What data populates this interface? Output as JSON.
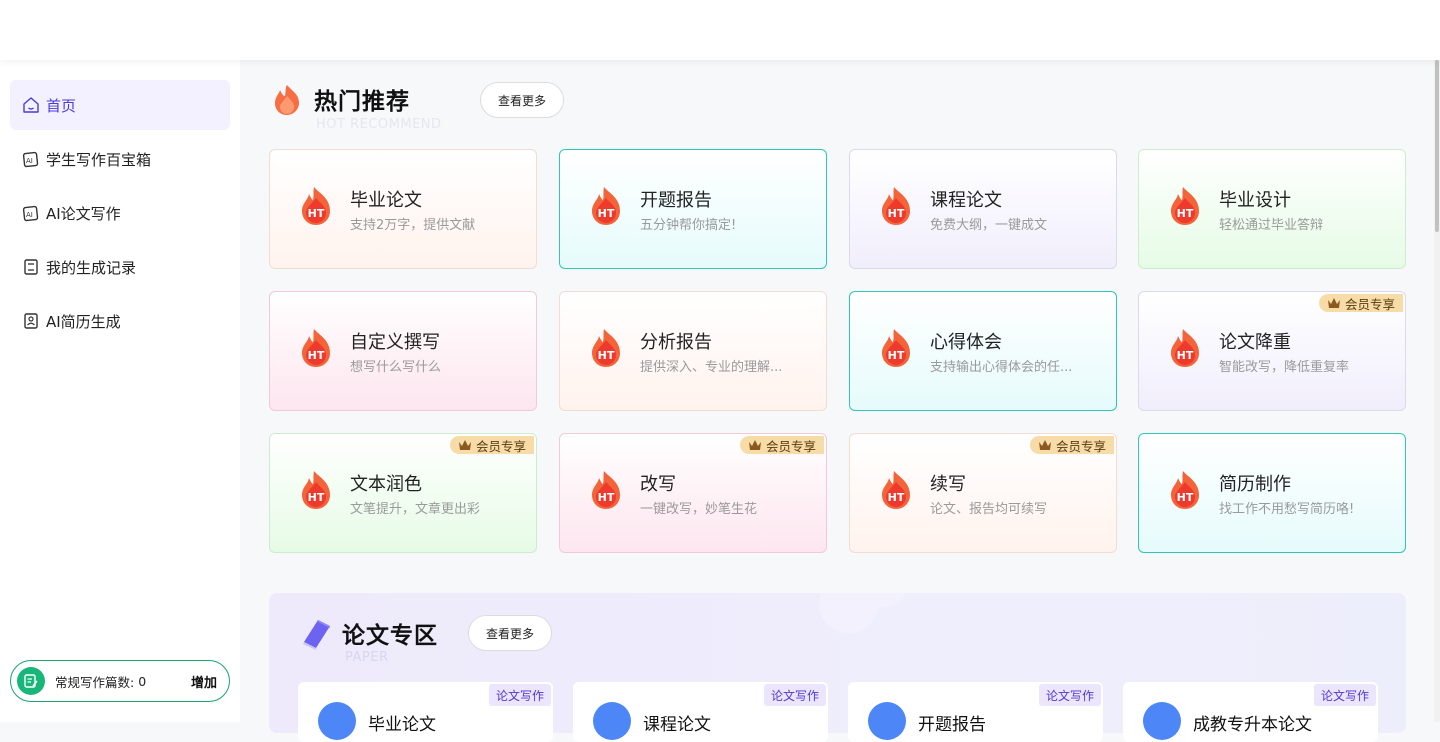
{
  "sidebar": {
    "items": [
      {
        "label": "首页",
        "icon": "home-icon",
        "active": true
      },
      {
        "label": "学生写作百宝箱",
        "icon": "ai-doc-icon"
      },
      {
        "label": "AI论文写作",
        "icon": "ai-doc-icon"
      },
      {
        "label": "我的生成记录",
        "icon": "record-icon"
      },
      {
        "label": "AI简历生成",
        "icon": "resume-icon"
      }
    ],
    "quota": {
      "label": "常规写作篇数:",
      "count": "0",
      "add_label": "增加"
    }
  },
  "hot": {
    "title": "热门推荐",
    "subtitle": "HOT RECOMMEND",
    "more_label": "查看更多",
    "cards": [
      {
        "title": "毕业论文",
        "desc": "支持2万字，提供文献",
        "badge": ""
      },
      {
        "title": "开题报告",
        "desc": "五分钟帮你搞定!",
        "badge": ""
      },
      {
        "title": "课程论文",
        "desc": "免费大纲，一键成文",
        "badge": ""
      },
      {
        "title": "毕业设计",
        "desc": "轻松通过毕业答辩",
        "badge": ""
      },
      {
        "title": "自定义撰写",
        "desc": "想写什么写什么",
        "badge": ""
      },
      {
        "title": "分析报告",
        "desc": "提供深入、专业的理解...",
        "badge": ""
      },
      {
        "title": "心得体会",
        "desc": "支持输出心得体会的任...",
        "badge": ""
      },
      {
        "title": "论文降重",
        "desc": "智能改写，降低重复率",
        "badge": "会员专享"
      },
      {
        "title": "文本润色",
        "desc": "文笔提升，文章更出彩",
        "badge": "会员专享"
      },
      {
        "title": "改写",
        "desc": "一键改写，妙笔生花",
        "badge": "会员专享"
      },
      {
        "title": "续写",
        "desc": "论文、报告均可续写",
        "badge": "会员专享"
      },
      {
        "title": "简历制作",
        "desc": "找工作不用愁写简历咯!",
        "badge": ""
      }
    ],
    "icon_text": "HT"
  },
  "paper": {
    "title": "论文专区",
    "subtitle": "PAPER",
    "more_label": "查看更多",
    "cards": [
      {
        "title": "毕业论文",
        "tag": "论文写作"
      },
      {
        "title": "课程论文",
        "tag": "论文写作"
      },
      {
        "title": "开题报告",
        "tag": "论文写作"
      },
      {
        "title": "成教专升本论文",
        "tag": "论文写作"
      }
    ]
  },
  "colors": {
    "accent": "#4b3bd6",
    "quota_green": "#19b67b",
    "fire": "#f4643a"
  }
}
